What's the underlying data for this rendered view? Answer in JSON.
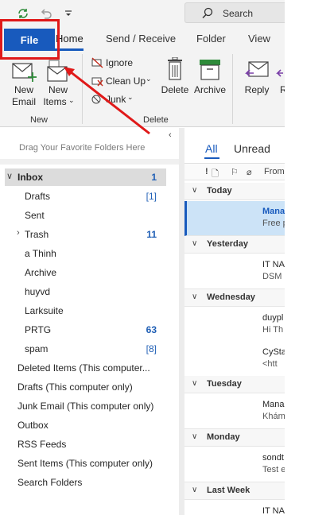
{
  "search": {
    "label": "Search"
  },
  "tabs": {
    "file": "File",
    "home": "Home",
    "send_receive": "Send / Receive",
    "folder": "Folder",
    "view": "View"
  },
  "ribbon": {
    "new_email": [
      "New",
      "Email"
    ],
    "new_items": [
      "New",
      "Items"
    ],
    "ignore": "Ignore",
    "clean_up": "Clean Up",
    "junk": "Junk",
    "delete": "Delete",
    "archive": "Archive",
    "reply": "Reply",
    "reply_all_partial": "R",
    "group_new": "New",
    "group_delete": "Delete"
  },
  "folder_pane": {
    "drag_hint": "Drag Your Favorite Folders Here",
    "inbox": {
      "label": "Inbox",
      "count": "1"
    },
    "items": [
      {
        "label": "Drafts",
        "count": "[1]"
      },
      {
        "label": "Sent",
        "count": ""
      },
      {
        "label": "Trash",
        "count": "11"
      },
      {
        "label": "a Thinh",
        "count": ""
      },
      {
        "label": "Archive",
        "count": ""
      },
      {
        "label": "huyvd",
        "count": ""
      },
      {
        "label": "Larksuite",
        "count": ""
      },
      {
        "label": "PRTG",
        "count": "63"
      },
      {
        "label": "spam",
        "count": "[8]"
      }
    ],
    "other_folders": [
      "Deleted Items (This computer...",
      "Drafts (This computer only)",
      "Junk Email (This computer only)",
      "Outbox",
      "RSS Feeds",
      "Sent Items (This computer only)",
      "Search Folders"
    ]
  },
  "message_list": {
    "tab_all": "All",
    "tab_unread": "Unread",
    "col_from": "From",
    "groups": [
      {
        "label": "Today",
        "items": [
          {
            "from": "Mana",
            "preview": "Free p"
          }
        ]
      },
      {
        "label": "Yesterday",
        "items": [
          {
            "from": "IT NA",
            "preview": "DSM"
          }
        ]
      },
      {
        "label": "Wednesday",
        "items": [
          {
            "from": "duypl",
            "preview": "Hi Th"
          },
          {
            "from": "CySta",
            "preview": "<htt"
          }
        ]
      },
      {
        "label": "Tuesday",
        "items": [
          {
            "from": "Mana",
            "preview": "Khám"
          }
        ]
      },
      {
        "label": "Monday",
        "items": [
          {
            "from": "sondt",
            "preview": "Test e"
          }
        ]
      },
      {
        "label": "Last Week",
        "items": [
          {
            "from": "IT NA",
            "preview": ""
          }
        ]
      }
    ]
  },
  "colors": {
    "accent": "#185abd",
    "annotation": "#e01919",
    "selected_row": "#cce3f7"
  }
}
